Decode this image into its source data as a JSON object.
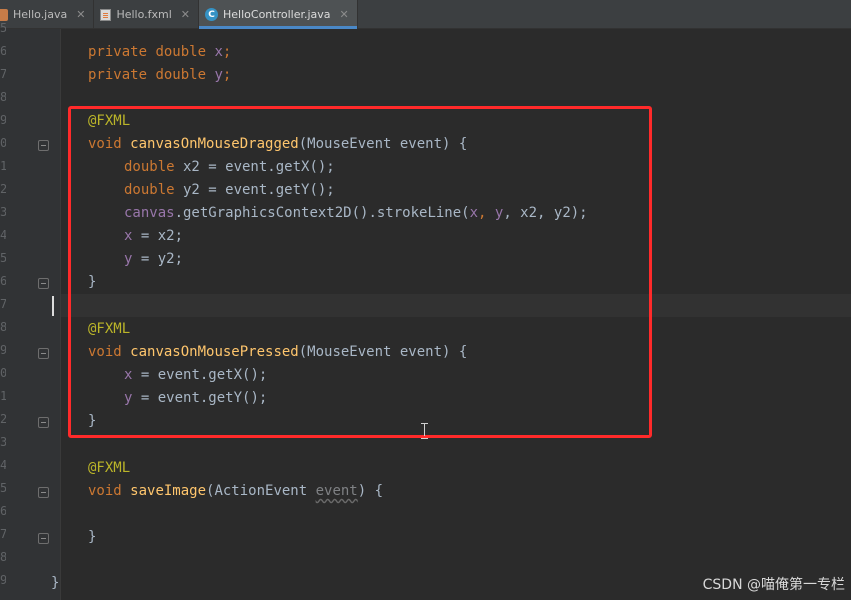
{
  "tabs": [
    {
      "label": "Hello.java",
      "icon": "java-file-icon"
    },
    {
      "label": "Hello.fxml",
      "icon": "fxml-file-icon"
    },
    {
      "label": "HelloController.java",
      "icon": "class-icon",
      "active": true
    }
  ],
  "gutter": {
    "line_numbers": [
      "5",
      "6",
      "7",
      "8",
      "9",
      "0",
      "1",
      "2",
      "3",
      "4",
      "5",
      "6",
      "7",
      "8",
      "9",
      "0",
      "1",
      "2",
      "3",
      "4",
      "5",
      "6",
      "7",
      "8",
      "9"
    ]
  },
  "code": {
    "l1": {
      "kw": "private",
      "type": "double",
      "name": "x",
      "end": ";"
    },
    "l2": {
      "kw": "private",
      "type": "double",
      "name": "y",
      "end": ";"
    },
    "l4": {
      "ann": "@FXML"
    },
    "l5": {
      "kw": "void",
      "fn": "canvasOnMouseDragged",
      "open": "(MouseEvent event) {"
    },
    "l6": {
      "type": "double",
      "rest": " x2 = event.getX();"
    },
    "l7": {
      "type": "double",
      "rest": " y2 = event.getY();"
    },
    "l8": {
      "field": "canvas",
      "rest": ".getGraphicsContext2D().strokeLine(",
      "a1": "x",
      "c1": ", ",
      "a2": "y",
      "c2": ", x2, y2);"
    },
    "l9": {
      "field": "x",
      "rest": " = x2;"
    },
    "l10": {
      "field": "y",
      "rest": " = y2;"
    },
    "l11": {
      "text": "}"
    },
    "l13": {
      "ann": "@FXML"
    },
    "l14": {
      "kw": "void",
      "fn": "canvasOnMousePressed",
      "open": "(MouseEvent event) {"
    },
    "l15": {
      "field": "x",
      "rest": " = event.getX();"
    },
    "l16": {
      "field": "y",
      "rest": " = event.getY();"
    },
    "l17": {
      "text": "}"
    },
    "l19": {
      "ann": "@FXML"
    },
    "l20": {
      "kw": "void",
      "fn": "saveImage",
      "open": "(ActionEvent ",
      "param": "event",
      "close": ") {"
    },
    "l22": {
      "text": "}"
    },
    "l24": {
      "text": "}"
    }
  },
  "watermark": "CSDN @喵俺第一专栏",
  "colors": {
    "keyword": "#cc7832",
    "annotation": "#bbb529",
    "method": "#ffc66d",
    "field": "#9876aa",
    "text": "#a9b7c6",
    "highlight_box": "#ff2a2a",
    "background": "#2b2b2b"
  }
}
